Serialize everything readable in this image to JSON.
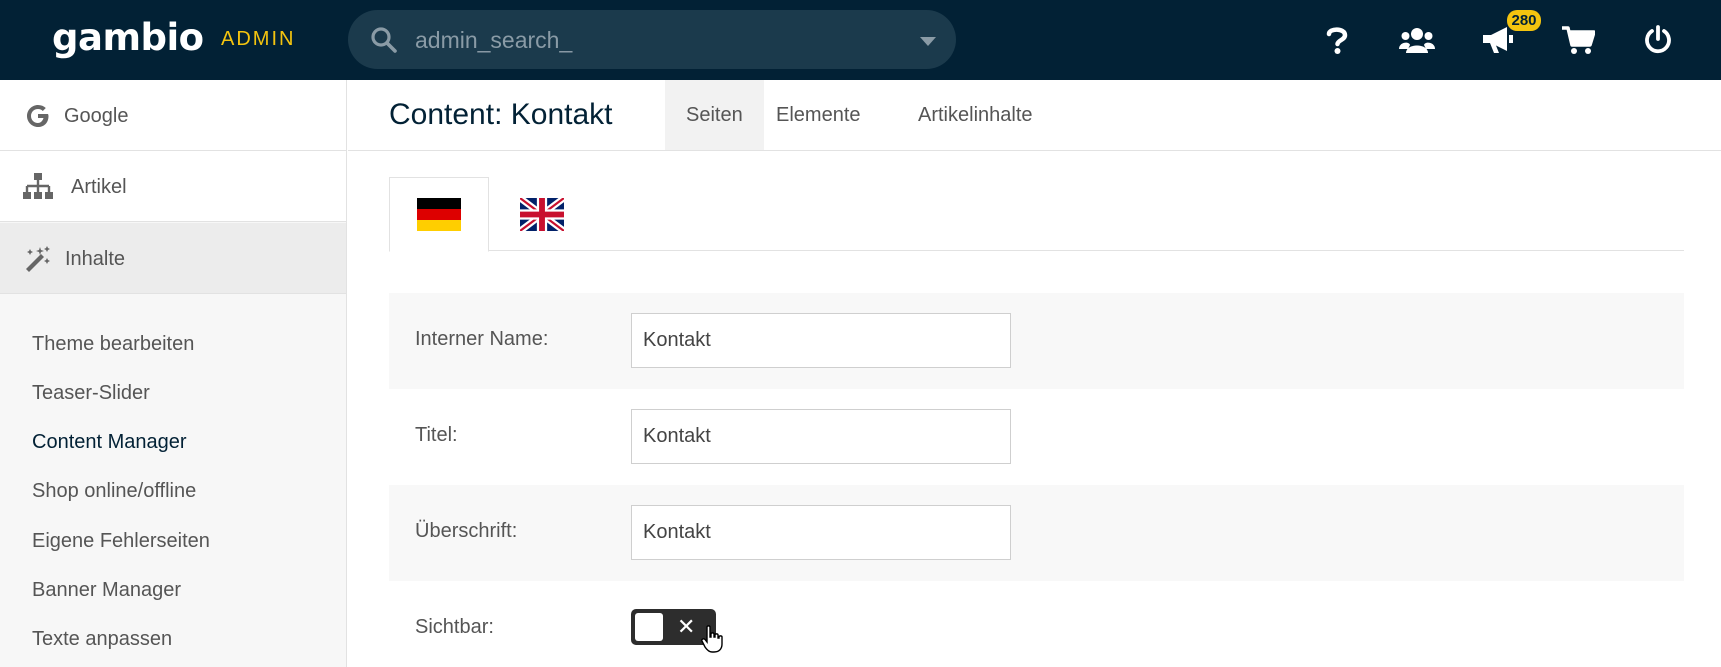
{
  "header": {
    "logo": "gambio",
    "admin_label": "ADMIN",
    "search_placeholder": "admin_search_",
    "notification_count": "280"
  },
  "sidebar": {
    "nav": [
      {
        "label": "Google",
        "icon": "google-icon"
      },
      {
        "label": "Artikel",
        "icon": "sitemap-icon"
      },
      {
        "label": "Inhalte",
        "icon": "magic-wand-icon"
      }
    ],
    "sub_items": [
      {
        "label": "Theme bearbeiten"
      },
      {
        "label": "Teaser-Slider"
      },
      {
        "label": "Content Manager"
      },
      {
        "label": "Shop online/offline"
      },
      {
        "label": "Eigene Fehlerseiten"
      },
      {
        "label": "Banner Manager"
      },
      {
        "label": "Texte anpassen"
      }
    ]
  },
  "main": {
    "title": "Content: Kontakt",
    "tabs": [
      {
        "label": "Seiten"
      },
      {
        "label": "Elemente"
      },
      {
        "label": "Artikelinhalte"
      }
    ],
    "languages": [
      "german-flag-icon",
      "uk-flag-icon"
    ],
    "form": {
      "internal_name": {
        "label": "Interner Name:",
        "value": "Kontakt"
      },
      "title": {
        "label": "Titel:",
        "value": "Kontakt"
      },
      "heading": {
        "label": "Überschrift:",
        "value": "Kontakt"
      },
      "visible": {
        "label": "Sichtbar:",
        "toggle_symbol": "✕"
      }
    }
  },
  "colors": {
    "topbar": "#022135",
    "accent": "#f4c40f"
  }
}
